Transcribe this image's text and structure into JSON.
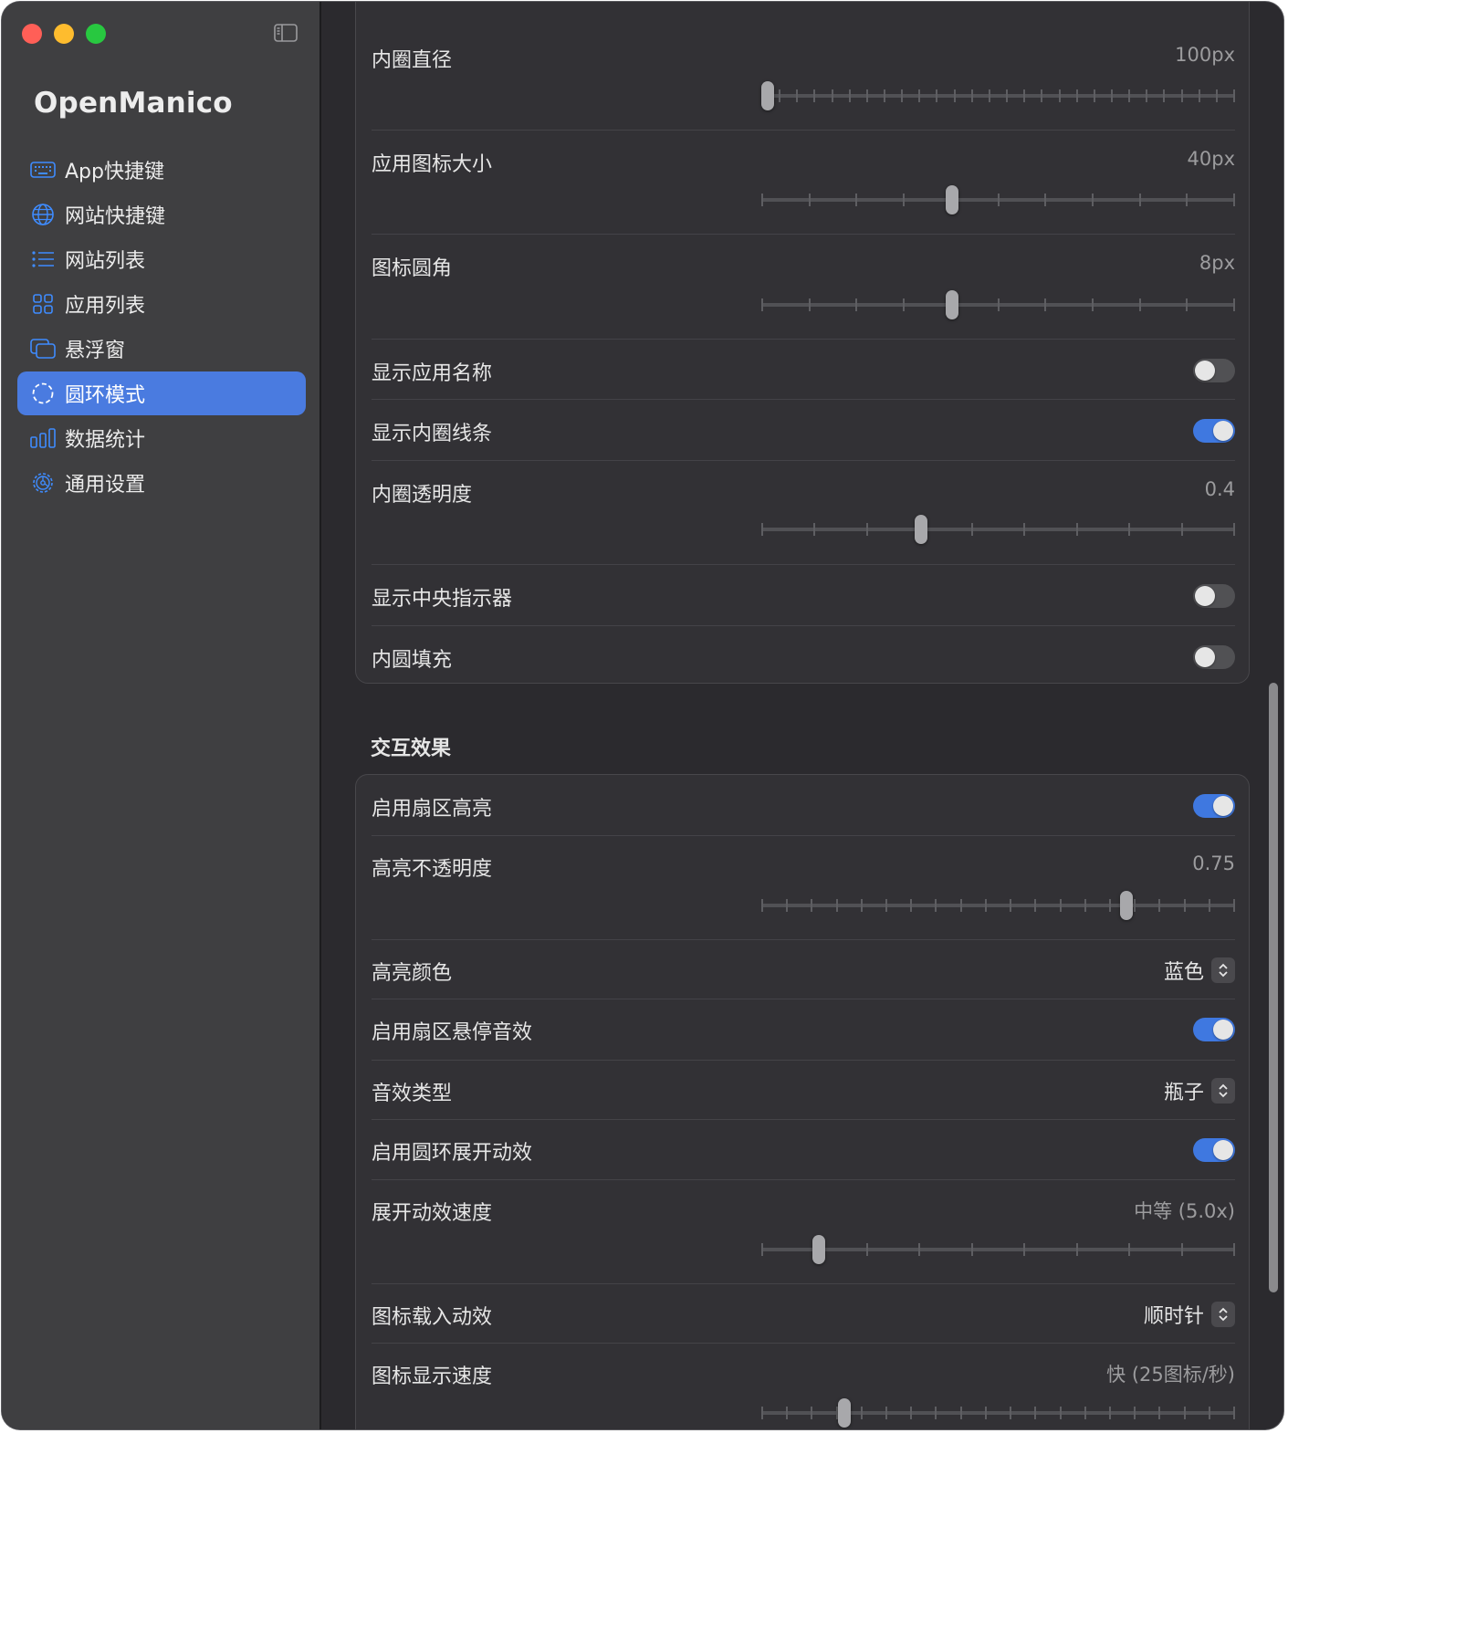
{
  "app": {
    "title": "OpenManico"
  },
  "sidebar": {
    "items": [
      {
        "label": "App快捷键",
        "icon": "keyboard-icon",
        "active": false
      },
      {
        "label": "网站快捷键",
        "icon": "globe-icon",
        "active": false
      },
      {
        "label": "网站列表",
        "icon": "list-icon",
        "active": false
      },
      {
        "label": "应用列表",
        "icon": "grid-icon",
        "active": false
      },
      {
        "label": "悬浮窗",
        "icon": "windows-icon",
        "active": false
      },
      {
        "label": "圆环模式",
        "icon": "dashed-circle-icon",
        "active": true
      },
      {
        "label": "数据统计",
        "icon": "bar-chart-icon",
        "active": false
      },
      {
        "label": "通用设置",
        "icon": "gear-icon",
        "active": false
      }
    ]
  },
  "colors": {
    "accent": "#4a7be0",
    "toggle_on": "#3f78e0",
    "background": "#2b2a2e",
    "sidebar": "#3f3f41"
  },
  "group1": {
    "inner_diameter": {
      "label": "内圈直径",
      "value": "100px",
      "ticks": 28,
      "fraction": 0.0
    },
    "icon_size": {
      "label": "应用图标大小",
      "value": "40px",
      "ticks": 11,
      "fraction": 0.4
    },
    "icon_radius": {
      "label": "图标圆角",
      "value": "8px",
      "ticks": 11,
      "fraction": 0.4
    },
    "show_app_name": {
      "label": "显示应用名称",
      "on": false
    },
    "show_inner_line": {
      "label": "显示内圈线条",
      "on": true
    },
    "inner_opacity": {
      "label": "内圈透明度",
      "value": "0.4",
      "ticks": 10,
      "fraction": 0.333
    },
    "show_center_indicator": {
      "label": "显示中央指示器",
      "on": false
    },
    "inner_fill": {
      "label": "内圆填充",
      "on": false
    }
  },
  "group2": {
    "header": "交互效果",
    "enable_sector_highlight": {
      "label": "启用扇区高亮",
      "on": true
    },
    "highlight_opacity": {
      "label": "高亮不透明度",
      "value": "0.75",
      "ticks": 20,
      "fraction": 0.7778
    },
    "highlight_color": {
      "label": "高亮颜色",
      "value": "蓝色"
    },
    "enable_hover_sound": {
      "label": "启用扇区悬停音效",
      "on": true
    },
    "sound_type": {
      "label": "音效类型",
      "value": "瓶子"
    },
    "enable_expand_anim": {
      "label": "启用圆环展开动效",
      "on": true
    },
    "expand_speed": {
      "label": "展开动效速度",
      "value": "中等 (5.0x)",
      "ticks": 10,
      "fraction": 0.111
    },
    "icon_load_anim": {
      "label": "图标载入动效",
      "value": "顺时针"
    },
    "icon_show_speed": {
      "label": "图标显示速度",
      "value": "快 (25图标/秒)",
      "ticks": 20,
      "fraction": 0.167
    }
  }
}
